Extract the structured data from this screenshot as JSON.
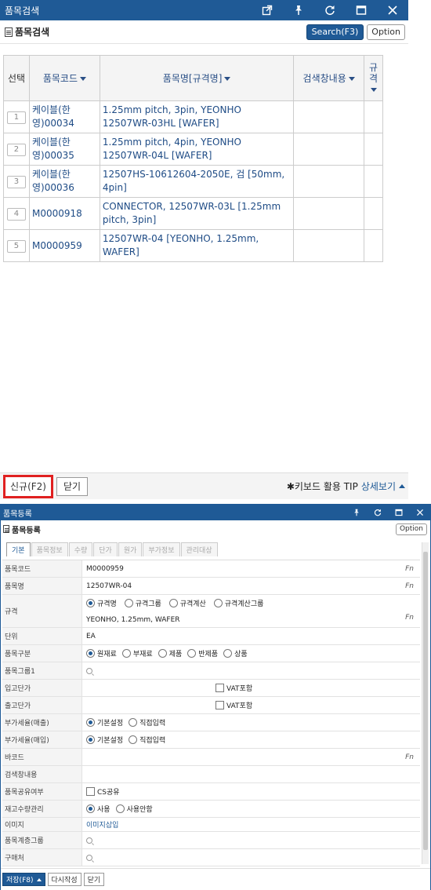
{
  "search_window": {
    "title": "품목검색",
    "heading": "품목검색",
    "search_btn": "Search(F3)",
    "option_btn": "Option",
    "columns": [
      "선택",
      "품목코드",
      "품목명[규격명]",
      "검색창내용",
      "규격"
    ],
    "rows": [
      {
        "num": "1",
        "code": "케이블(한영)00034",
        "name": "1.25mm pitch, 3pin, YEONHO 12507WR-03HL [WAFER]",
        "search": ""
      },
      {
        "num": "2",
        "code": "케이블(한영)00035",
        "name": "1.25mm pitch, 4pin, YEONHO 12507WR-04L [WAFER]",
        "search": ""
      },
      {
        "num": "3",
        "code": "케이블(한영)00036",
        "name": "12507HS-10612604-2050E, 검 [50mm, 4pin]",
        "search": ""
      },
      {
        "num": "4",
        "code": "M0000918",
        "name": "CONNECTOR, 12507WR-03L [1.25mm pitch, 3pin]",
        "search": ""
      },
      {
        "num": "5",
        "code": "M0000959",
        "name": "12507WR-04 [YEONHO, 1.25mm, WAFER]",
        "search": ""
      }
    ],
    "new_btn": "신규(F2)",
    "close_btn": "닫기",
    "tip": "✱키보드 활용 TIP",
    "tip_link": "상세보기"
  },
  "reg_window": {
    "title": "품목등록",
    "heading": "품목등록",
    "option_btn": "Option",
    "tabs": [
      "기본",
      "품목정보",
      "수량",
      "단가",
      "원가",
      "부가정보",
      "관리대상"
    ],
    "fn": "Fn",
    "labels": {
      "code": "품목코드",
      "name": "품목명",
      "spec": "규격",
      "unit": "단위",
      "kind": "품목구분",
      "group1": "품목그룹1",
      "in_price": "입고단가",
      "out_price": "출고단가",
      "vat_sale": "부가세율(매출)",
      "vat_buy": "부가세율(매입)",
      "barcode": "바코드",
      "search": "검색창내용",
      "share": "품목공유여부",
      "stock": "재고수량관리",
      "image": "이미지",
      "class_group": "품목계층그룹",
      "vendor": "구매처"
    },
    "values": {
      "code": "M0000959",
      "name": "12507WR-04",
      "spec_text": "YEONHO, 1.25mm, WAFER",
      "unit": "EA",
      "vat": "VAT포함",
      "cs": "CS공유",
      "image_link": "이미지삽입"
    },
    "spec_opts": [
      "규격명",
      "규격그룹",
      "규격계산",
      "규격계산그룹"
    ],
    "kind_opts": [
      "원재료",
      "부재료",
      "제품",
      "반제품",
      "상품"
    ],
    "vat_opts": [
      "기본설정",
      "직접입력"
    ],
    "stock_opts": [
      "사용",
      "사용안함"
    ],
    "save_btn": "저장(F8)",
    "rewrite_btn": "다시작성",
    "close_btn": "닫기"
  }
}
